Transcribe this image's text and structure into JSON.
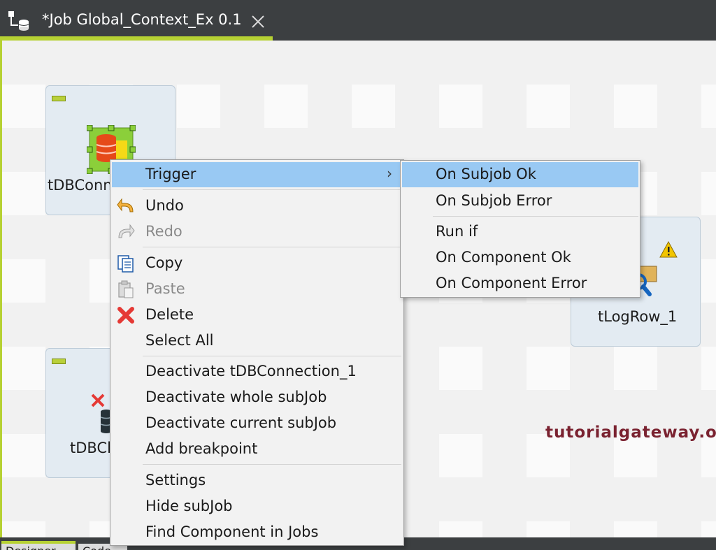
{
  "editor_tab": {
    "title": "*Job Global_Context_Ex 0.1",
    "close_icon": "close-icon"
  },
  "nodes": {
    "db_connection": {
      "label": "tDBConn"
    },
    "db_close": {
      "label": "tDBCl"
    },
    "log_row": {
      "label": "tLogRow_1"
    }
  },
  "bottom_tabs": [
    "Designer",
    "Code"
  ],
  "watermark": "tutorialgateway.org",
  "context_menu": {
    "trigger": "Trigger",
    "undo": "Undo",
    "redo": "Redo",
    "copy": "Copy",
    "paste": "Paste",
    "delete": "Delete",
    "select_all": "Select All",
    "deactivate_component": "Deactivate tDBConnection_1",
    "deactivate_whole": "Deactivate whole subJob",
    "deactivate_current": "Deactivate current subJob",
    "add_breakpoint": "Add breakpoint",
    "settings": "Settings",
    "hide_subjob": "Hide subJob",
    "find_component": "Find Component in Jobs",
    "submenu_arrow": "›"
  },
  "trigger_submenu": {
    "on_subjob_ok": "On Subjob Ok",
    "on_subjob_error": "On Subjob Error",
    "run_if": "Run if",
    "on_component_ok": "On Component Ok",
    "on_component_error": "On Component Error"
  },
  "colors": {
    "accent": "#b6d133",
    "highlight": "#99c9f3",
    "tabbar": "#3c3f41"
  }
}
